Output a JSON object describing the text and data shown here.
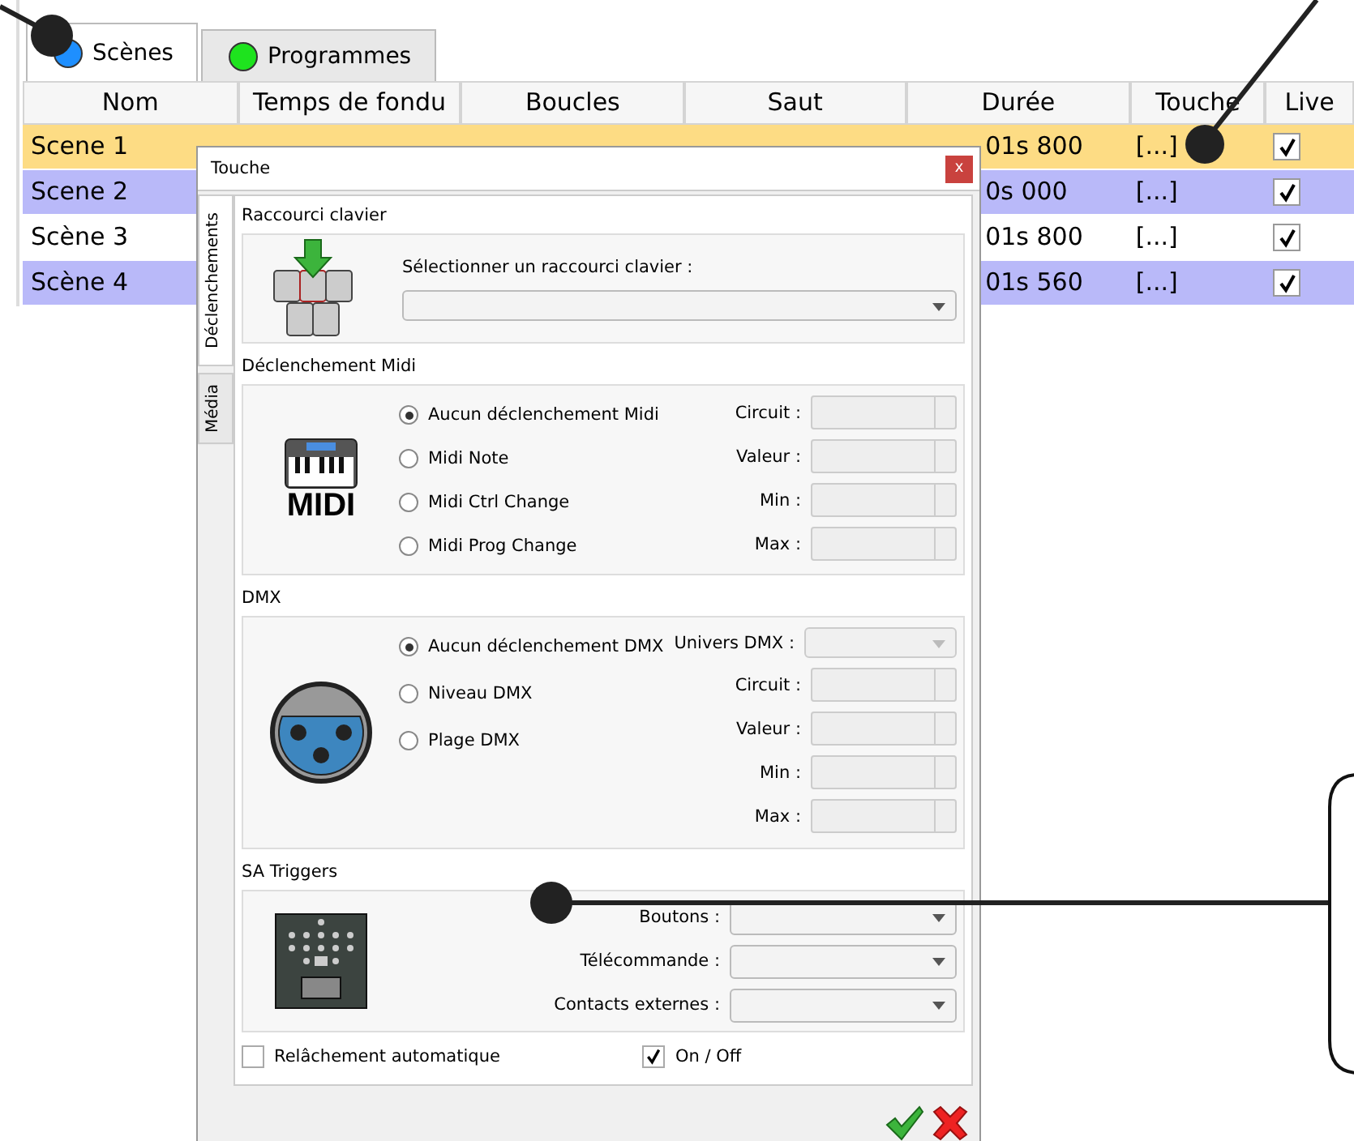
{
  "main_tabs": [
    {
      "label": "Scènes",
      "color": "#1e8fff",
      "selected": true
    },
    {
      "label": "Programmes",
      "color": "#1ee31e",
      "selected": false
    }
  ],
  "table": {
    "columns": [
      "Nom",
      "Temps de fondu",
      "Boucles",
      "Saut",
      "Durée",
      "Touche",
      "Live"
    ],
    "rows": [
      {
        "name": "Scene 1",
        "duration": "01s 800",
        "key": "[...]",
        "live": true,
        "color": "#fddc84"
      },
      {
        "name": "Scene 2",
        "duration": "0s 000",
        "key": "[...]",
        "live": true,
        "color": "#b9b9f9"
      },
      {
        "name": "Scène 3",
        "duration": "01s 800",
        "key": "[...]",
        "live": true,
        "color": "#ffffff"
      },
      {
        "name": "Scène 4",
        "duration": "01s 560",
        "key": "[...]",
        "live": true,
        "color": "#b9b9f9"
      }
    ]
  },
  "dialog": {
    "title": "Touche",
    "close": "x",
    "side_tabs": [
      {
        "label": "Déclenchements",
        "selected": true
      },
      {
        "label": "Média",
        "selected": false
      }
    ],
    "keyboard": {
      "title": "Raccourci clavier",
      "label": "Sélectionner un raccourci clavier :"
    },
    "midi": {
      "title": "Déclenchement Midi",
      "logo": "MIDI",
      "options": [
        {
          "label": "Aucun déclenchement Midi",
          "selected": true
        },
        {
          "label": "Midi Note",
          "selected": false
        },
        {
          "label": "Midi Ctrl Change",
          "selected": false
        },
        {
          "label": "Midi Prog Change",
          "selected": false
        }
      ],
      "fields": [
        {
          "label": "Circuit :",
          "disabled": true
        },
        {
          "label": "Valeur :",
          "disabled": true
        },
        {
          "label": "Min :",
          "disabled": true
        },
        {
          "label": "Max :",
          "disabled": true
        }
      ]
    },
    "dmx": {
      "title": "DMX",
      "options": [
        {
          "label": "Aucun déclenchement DMX",
          "selected": true
        },
        {
          "label": "Niveau DMX",
          "selected": false
        },
        {
          "label": "Plage DMX",
          "selected": false
        }
      ],
      "universe": {
        "label": "Univers DMX :",
        "disabled": true
      },
      "fields": [
        {
          "label": "Circuit :",
          "disabled": true
        },
        {
          "label": "Valeur :",
          "disabled": true
        },
        {
          "label": "Min :",
          "disabled": true
        },
        {
          "label": "Max :",
          "disabled": true
        }
      ]
    },
    "sa_triggers": {
      "title": "SA Triggers",
      "fields": [
        {
          "label": "Boutons :",
          "disabled": false
        },
        {
          "label": "Télécommande :",
          "disabled": false
        },
        {
          "label": "Contacts externes :",
          "disabled": false
        }
      ]
    },
    "checkboxes": [
      {
        "label": "Relâchement automatique",
        "checked": false
      },
      {
        "label": "On / Off",
        "checked": true
      }
    ]
  }
}
